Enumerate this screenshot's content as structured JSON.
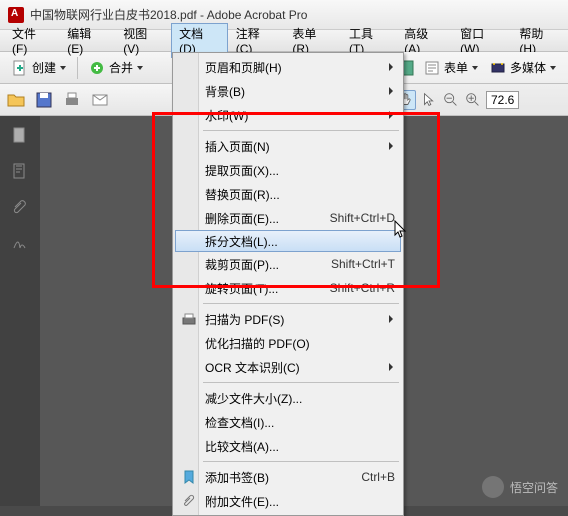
{
  "title": "中国物联网行业白皮书2018.pdf - Adobe Acrobat Pro",
  "menubar": {
    "file": "文件(F)",
    "edit": "编辑(E)",
    "view": "视图(V)",
    "document": "文档(D)",
    "comment": "注释(C)",
    "forms": "表单(R)",
    "tools": "工具(T)",
    "advanced": "高级(A)",
    "window": "窗口(W)",
    "help": "帮助(H)"
  },
  "toolbar": {
    "create": "创建",
    "merge": "合并",
    "forms": "表单",
    "multimedia": "多媒体"
  },
  "zoom": {
    "value": "72.6"
  },
  "menu": {
    "header_footer": "页眉和页脚(H)",
    "background": "背景(B)",
    "watermark": "水印(W)",
    "insert_pages": "插入页面(N)",
    "extract_pages": "提取页面(X)...",
    "replace_pages": "替换页面(R)...",
    "delete_pages": {
      "label": "删除页面(E)...",
      "shortcut": "Shift+Ctrl+D"
    },
    "split_doc": "拆分文档(L)...",
    "crop_pages": {
      "label": "裁剪页面(P)...",
      "shortcut": "Shift+Ctrl+T"
    },
    "rotate_pages": {
      "label": "旋转页面(T)...",
      "shortcut": "Shift+Ctrl+R"
    },
    "scan_to_pdf": "扫描为 PDF(S)",
    "optimize_scanned": "优化扫描的 PDF(O)",
    "ocr": "OCR 文本识别(C)",
    "reduce_size": "减少文件大小(Z)...",
    "examine": "检查文档(I)...",
    "compare": "比较文档(A)...",
    "add_bookmark": {
      "label": "添加书签(B)",
      "shortcut": "Ctrl+B"
    },
    "attach_file": "附加文件(E)..."
  },
  "watermark": "悟空问答"
}
